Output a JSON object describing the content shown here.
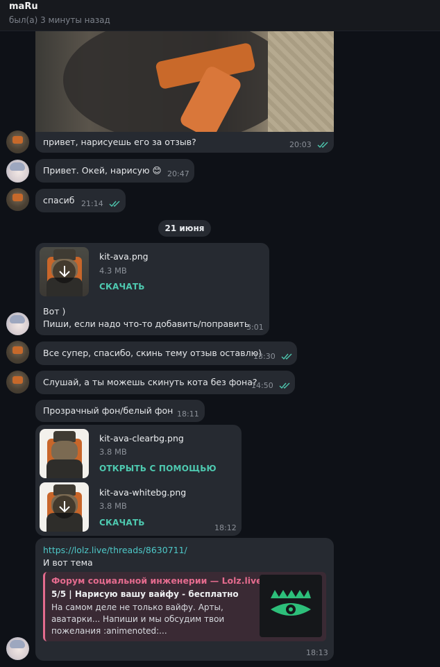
{
  "header": {
    "name": "maRu",
    "status": "был(а) 3 минуты назад"
  },
  "messages": [
    {
      "text": "привет, нарисуешь его за отзыв?",
      "time": "20:03",
      "read": true
    },
    {
      "text": "Привет. Окей, нарисую 😊",
      "time": "20:47"
    },
    {
      "text": "спасиб",
      "time": "21:14",
      "read": true
    },
    {
      "text": "Все супер, спасибо, скинь тему отзыв оставлю)",
      "time": "13:30",
      "read": true
    },
    {
      "text": "Слушай, а ты можешь скинуть кота без фона?",
      "time": "14:50",
      "read": true
    },
    {
      "text": "Прозрачный фон/белый фон",
      "time": "18:11"
    }
  ],
  "date_divider": "21 июня",
  "file_message": {
    "file": {
      "name": "kit-ava.png",
      "size": "4.3 MB",
      "action": "СКАЧАТЬ"
    },
    "line1": "Вот )",
    "line2": "Пиши, если надо что-то добавить/поправить",
    "time": "3:01"
  },
  "files_message": {
    "files": [
      {
        "name": "kit-ava-clearbg.png",
        "size": "3.8 MB",
        "action": "ОТКРЫТЬ С ПОМОЩЬЮ"
      },
      {
        "name": "kit-ava-whitebg.png",
        "size": "3.8 MB",
        "action": "СКАЧАТЬ"
      }
    ],
    "time": "18:12"
  },
  "link_message": {
    "url": "https://lolz.live/threads/8630711/",
    "text": "И вот тема",
    "preview": {
      "site": "Форум социальной инженерии — Lolz.live...",
      "title": "5/5 | Нарисую вашу вайфу - бесплатно",
      "description": "На самом деле не только вайфу. Арты, аватарки... Напиши и мы обсудим твои пожелания :animenoted:..."
    },
    "time": "18:13"
  },
  "colors": {
    "background": "#0e1117",
    "bubble": "#262a31",
    "accent": "#4ec9b0",
    "preview_accent": "#e46b8e"
  }
}
